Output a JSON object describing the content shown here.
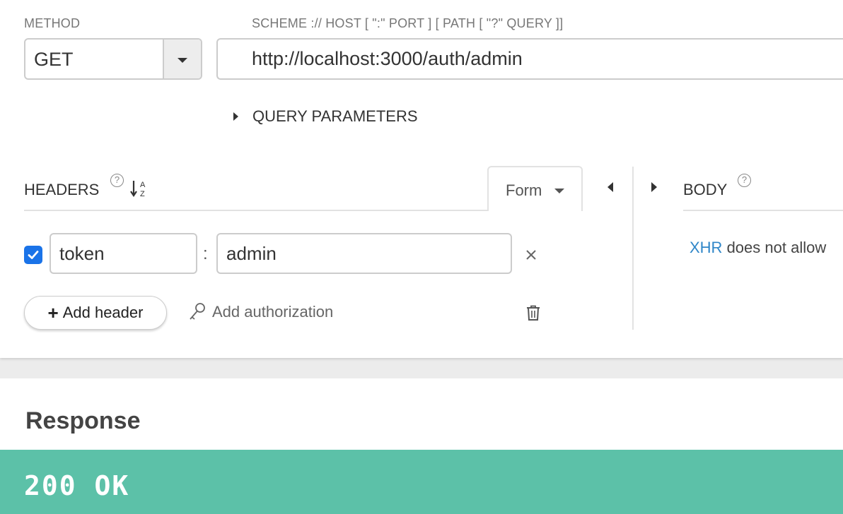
{
  "request": {
    "method_label": "METHOD",
    "url_label": "SCHEME :// HOST [ \":\" PORT ] [ PATH [ \"?\" QUERY ]]",
    "method_value": "GET",
    "url_value": "http://localhost:3000/auth/admin",
    "query_params_label": "QUERY PARAMETERS"
  },
  "headers": {
    "title": "HEADERS",
    "help": "?",
    "mode_tab": "Form",
    "rows": [
      {
        "enabled": true,
        "name": "token",
        "separator": ":",
        "value": "admin"
      }
    ],
    "add_header_label": "Add header",
    "add_auth_label": "Add authorization"
  },
  "body": {
    "title": "BODY",
    "help": "?",
    "note_link": "XHR",
    "note_text": " does not allow"
  },
  "response": {
    "title": "Response",
    "status": "200 OK",
    "status_color": "#5cc1a8"
  },
  "accent_color": "#1a73e8"
}
